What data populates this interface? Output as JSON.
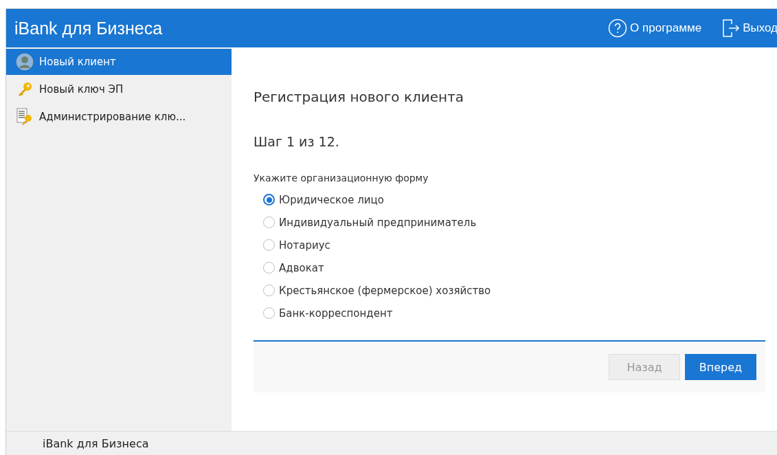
{
  "header": {
    "title": "iBank для Бизнеса",
    "actions": [
      {
        "kind": "about",
        "label": "О программе"
      },
      {
        "kind": "exit",
        "label": "Выход"
      }
    ]
  },
  "sidebar": {
    "items": [
      {
        "kind": "client",
        "label": "Новый клиент",
        "selected": true
      },
      {
        "kind": "key",
        "label": "Новый ключ ЭП",
        "selected": false
      },
      {
        "kind": "admin",
        "label": "Администрирование клю...",
        "selected": false
      }
    ]
  },
  "content": {
    "title": "Регистрация нового клиента",
    "step": "Шаг 1 из 12.",
    "question": "Укажите организационную форму",
    "options": [
      {
        "label": "Юридическое лицо",
        "selected": true
      },
      {
        "label": "Индивидуальный предприниматель",
        "selected": false
      },
      {
        "label": "Нотариус",
        "selected": false
      },
      {
        "label": "Адвокат",
        "selected": false
      },
      {
        "label": "Крестьянское (фермерское) хозяйство",
        "selected": false
      },
      {
        "label": "Банк-корреспондент",
        "selected": false
      }
    ],
    "buttons": [
      {
        "label": "Назад",
        "disabled": true
      },
      {
        "label": "Вперед",
        "disabled": false
      }
    ]
  },
  "status_bar": {
    "text": "iBank для Бизнеса"
  }
}
